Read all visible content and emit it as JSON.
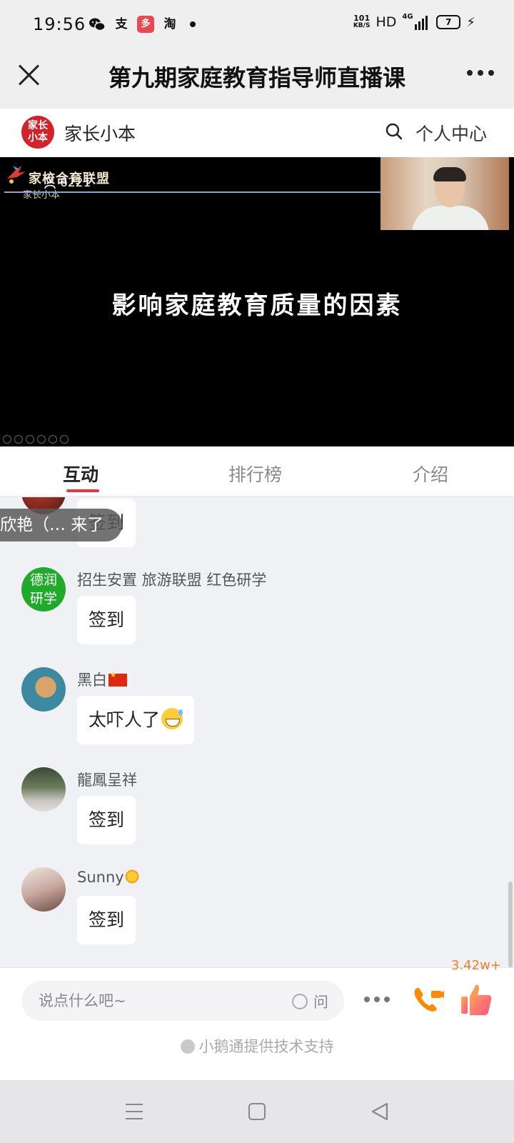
{
  "status_bar": {
    "time": "19:56",
    "app_icons": [
      "wechat-icon",
      "alipay-icon",
      "pinduoduo-icon",
      "taobao-icon"
    ],
    "alipay_glyph": "支",
    "pinduoduo_glyph": "多",
    "taobao_glyph": "淘",
    "net_speed_value": "101",
    "net_speed_unit": "KB/S",
    "hd": "HD",
    "network": "4G",
    "battery": "7"
  },
  "titlebar": {
    "title": "第九期家庭教育指导师直播课"
  },
  "header": {
    "logo_text_line1": "家长",
    "logo_text_line2": "小本",
    "site_name": "家长小本",
    "personal_center": "个人中心"
  },
  "video": {
    "brand": "家校合育联盟",
    "brand_sub": "家长小本",
    "viewer_count": "6221",
    "slide_text": "影响家庭教育质量的因素"
  },
  "tabs": [
    {
      "label": "互动",
      "active": true
    },
    {
      "label": "排行榜",
      "active": false
    },
    {
      "label": "介绍",
      "active": false
    }
  ],
  "enter_toast": "欣艳（… 来了",
  "messages": [
    {
      "name": "",
      "text": "签到",
      "avatar": "#7a2a22"
    },
    {
      "name": "招生安置 旅游联盟 红色研学",
      "text": "签到",
      "avatar": "#1faa2a",
      "avatar_text": "德润研学"
    },
    {
      "name": "黑白",
      "text": "太吓人了",
      "avatar": "#3d8aa0"
    },
    {
      "name": "龍鳳呈祥",
      "text": "签到",
      "avatar": "#6b7b5a"
    },
    {
      "name": "Sunny",
      "text": "签到",
      "avatar": "#c9a9a0"
    }
  ],
  "input": {
    "placeholder": "说点什么吧~",
    "ask_label": "问",
    "like_count": "3.42w+",
    "support_text": "小鹅通提供技术支持"
  },
  "colors": {
    "accent": "#e8383d",
    "like": "#f07f2a",
    "call": "#ff8a00"
  }
}
